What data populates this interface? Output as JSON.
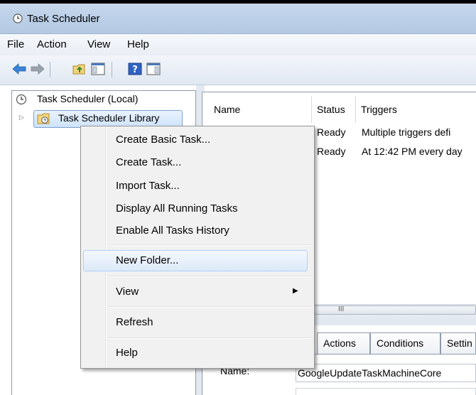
{
  "window": {
    "title": "Task Scheduler"
  },
  "menubar": {
    "items": [
      "File",
      "Action",
      "View",
      "Help"
    ]
  },
  "tree": {
    "root_label": "Task Scheduler (Local)",
    "library_label": "Task Scheduler Library"
  },
  "task_list": {
    "columns": [
      "Name",
      "Status",
      "Triggers"
    ],
    "rows": [
      {
        "status": "Ready",
        "triggers": "Multiple triggers defi"
      },
      {
        "status": "Ready",
        "triggers": "At 12:42 PM every day"
      }
    ],
    "scroll_grip": "III"
  },
  "detail": {
    "tabs": [
      "Actions",
      "Conditions",
      "Settin"
    ],
    "name_label": "Name:",
    "name_value": "GoogleUpdateTaskMachineCore"
  },
  "context_menu": {
    "items": [
      "Create Basic Task...",
      "Create Task...",
      "Import Task...",
      "Display All Running Tasks",
      "Enable All Tasks History",
      "New Folder...",
      "View",
      "Refresh",
      "Help"
    ],
    "highlighted_item": "New Folder..."
  },
  "colors": {
    "title_bar": "#bcd0e8",
    "menu_highlight_border": "#aecff7",
    "selection_border": "#7da2ce"
  },
  "icons": [
    "clock-icon",
    "back-arrow-icon",
    "forward-arrow-icon",
    "up-folder-icon",
    "show-hide-tree-icon",
    "help-icon",
    "show-hide-action-pane-icon",
    "folder-clock-icon",
    "chevron-right-icon"
  ]
}
